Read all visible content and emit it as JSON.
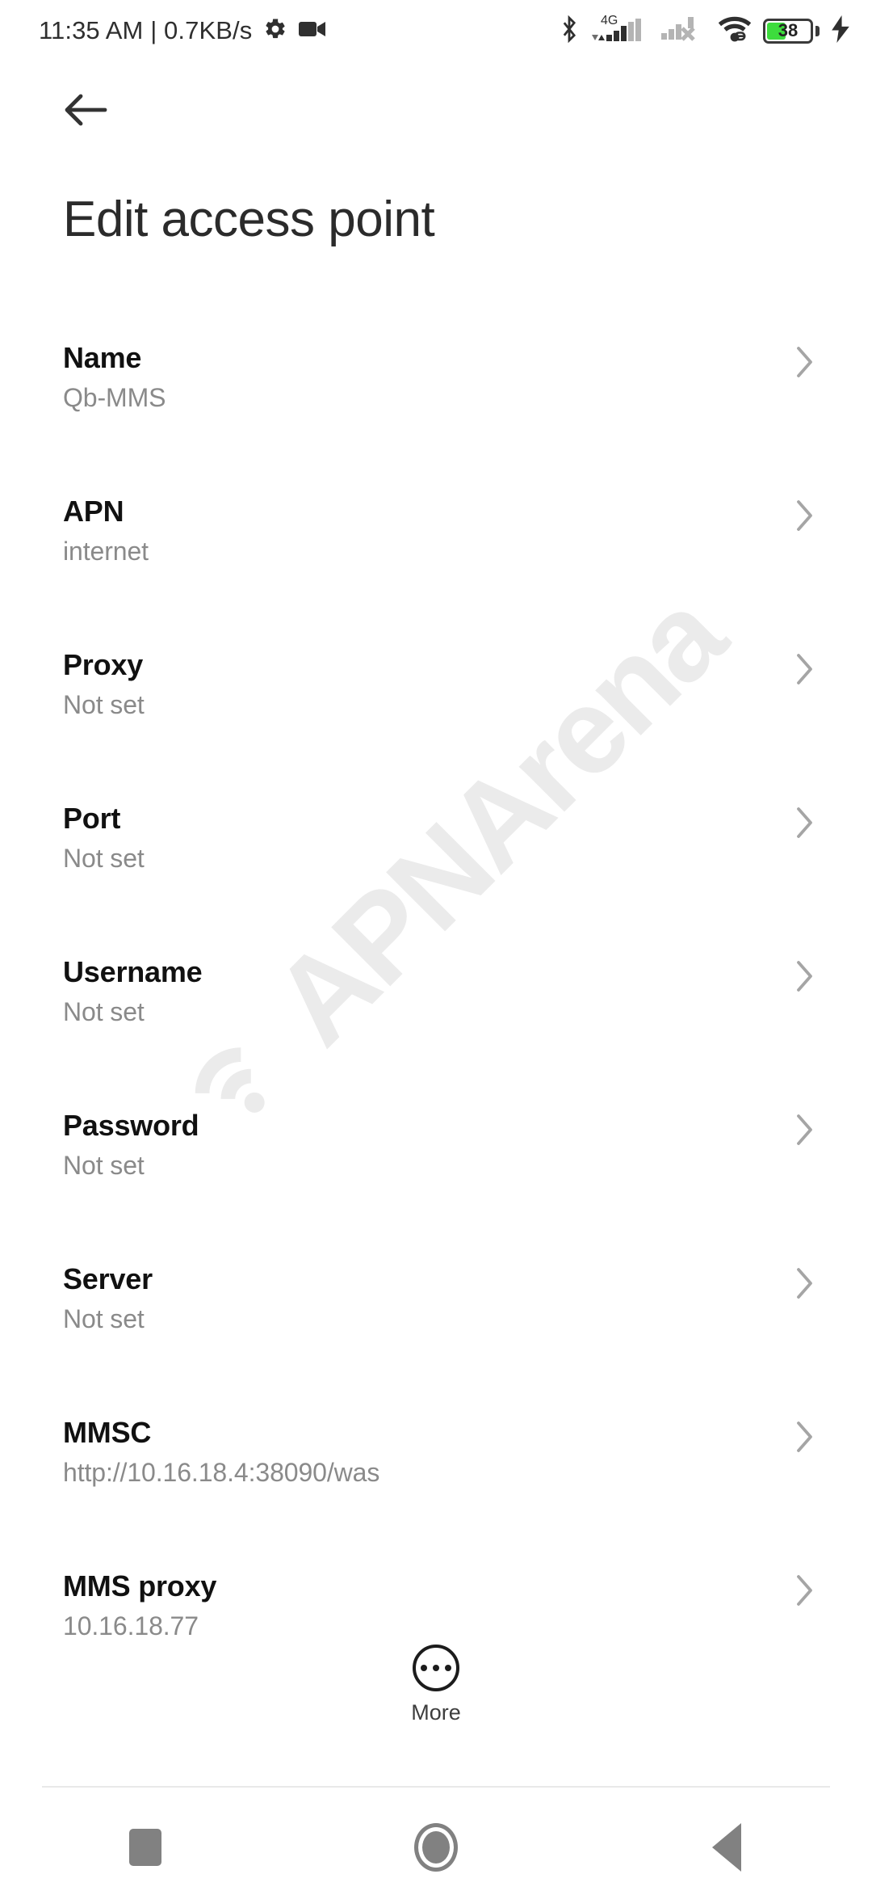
{
  "status_bar": {
    "clock": "11:35 AM | 0.7KB/s",
    "gear_icon": "gear-icon",
    "recording_icon": "video-camera-icon",
    "bluetooth_icon": "bluetooth-icon",
    "network_type": "4G",
    "sim1_icon": "signal-bars-4g-icon",
    "sim2_icon": "signal-bars-no-service-icon",
    "wifi_icon": "wifi-connected-icon",
    "battery_level": "38",
    "battery_fill_color": "#3ddc3d",
    "charging_icon": "charging-bolt-icon"
  },
  "app_bar": {
    "back_icon": "back-arrow-icon",
    "title": "Edit access point"
  },
  "watermark": {
    "text": "APNArena",
    "logo_icon": "wifi-arcs-icon",
    "color": "#ebebeb"
  },
  "settings_list": {
    "chevron_icon": "chevron-right-icon",
    "rows": [
      {
        "label": "Name",
        "value": "Qb-MMS"
      },
      {
        "label": "APN",
        "value": "internet"
      },
      {
        "label": "Proxy",
        "value": "Not set"
      },
      {
        "label": "Port",
        "value": "Not set"
      },
      {
        "label": "Username",
        "value": "Not set"
      },
      {
        "label": "Password",
        "value": "Not set"
      },
      {
        "label": "Server",
        "value": "Not set"
      },
      {
        "label": "MMSC",
        "value": "http://10.16.18.4:38090/was"
      },
      {
        "label": "MMS proxy",
        "value": "10.16.18.77"
      }
    ]
  },
  "more_button": {
    "label": "More",
    "icon": "more-dots-circle-icon"
  },
  "nav_bar": {
    "recents_icon": "recents-square-icon",
    "home_icon": "home-circle-icon",
    "back_icon": "back-triangle-icon",
    "color": "#818181"
  }
}
